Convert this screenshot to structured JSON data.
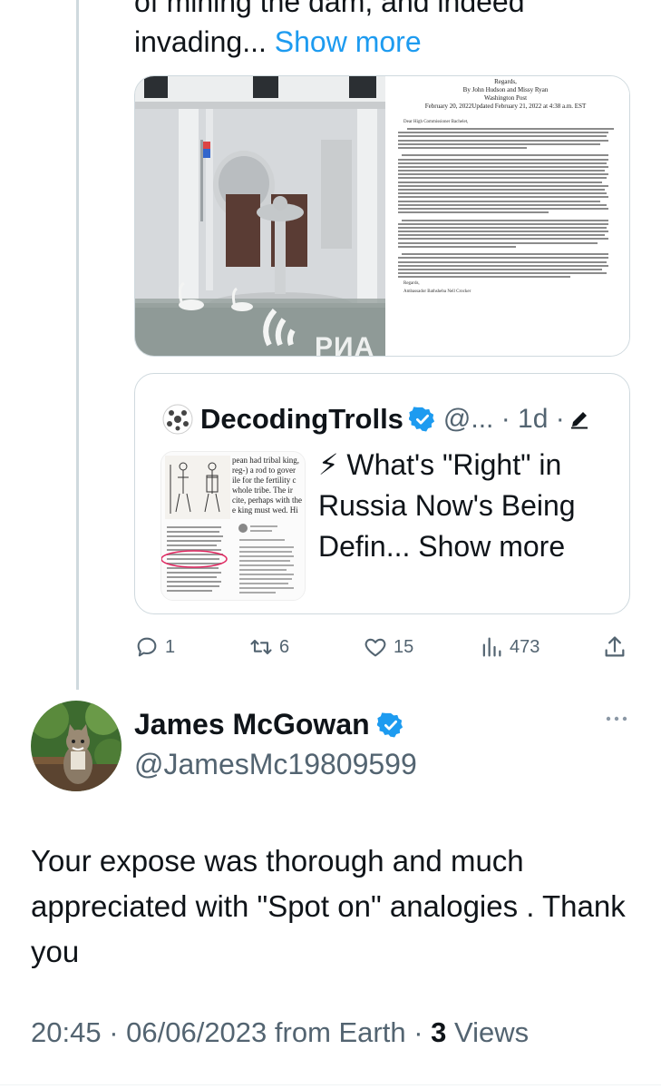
{
  "parent_tweet": {
    "text_tail_clipped": "of mining the dam, and indeed",
    "text_tail": "invading...",
    "show_more": "Show more",
    "media": {
      "photo_watermark": "РИА",
      "document": {
        "header_clipped": "Regards,",
        "byline": "By John Hudson and Missy Ryan",
        "outlet": "Washington Post",
        "dateline": "February 20, 2022Updated February 21, 2022 at 4:38 a.m. EST",
        "salutation": "Dear High Commissioner Bachelet,",
        "closing": "Regards,",
        "signature": "Ambassador Bathsheba Nell Crocker"
      }
    }
  },
  "quote_tweet": {
    "author_name": "DecodingTrolls",
    "author_meta": "@... · 1d ·",
    "text": "⚡ What's \"Right\" in Russia Now's Being Defin...",
    "show_more": "Show more",
    "thumbnail_text": {
      "line1": "pean had tribal king,",
      "line2": "reg-) a rod to gover",
      "line3": "ile for the fertility c",
      "line4": "whole tribe. The ir",
      "line5": "cite, perhaps with the",
      "line6": "e king must wed. Hi"
    }
  },
  "actions": {
    "replies": "1",
    "reposts": "6",
    "likes": "15",
    "views": "473"
  },
  "reply": {
    "author_name": "James McGowan",
    "handle": "@JamesMc19809599",
    "text": "Your expose was thorough and much appreciated  with \"Spot on\" analogies . Thank you",
    "timestamp": "20:45 · 06/06/2023 from Earth ·",
    "views_count": "3",
    "views_label": "Views"
  },
  "colors": {
    "link": "#1d9bf0",
    "muted": "#536471",
    "text": "#0f1419",
    "border": "#cfd9de",
    "verified": "#1d9bf0"
  }
}
